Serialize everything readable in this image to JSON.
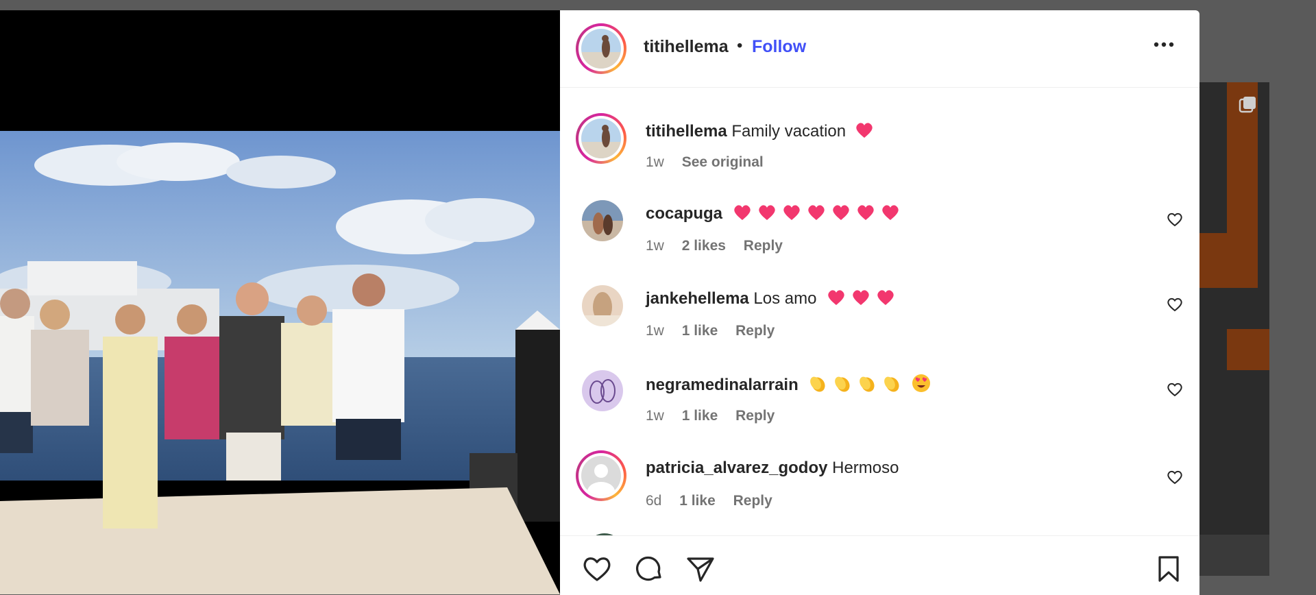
{
  "post": {
    "author": "titihellema",
    "follow_label": "Follow",
    "separator": "•",
    "caption": {
      "username": "titihellema",
      "text": "Family vacation",
      "time": "1w",
      "see_original": "See original"
    }
  },
  "comments": [
    {
      "username": "cocapuga",
      "text": "",
      "emoji_count": 7,
      "emoji": "heart",
      "time": "1w",
      "likes": "2 likes",
      "reply": "Reply"
    },
    {
      "username": "jankehellema",
      "text": "Los amo",
      "emoji_count": 3,
      "emoji": "heart",
      "time": "1w",
      "likes": "1 like",
      "reply": "Reply"
    },
    {
      "username": "negramedinalarrain",
      "text": "",
      "emoji_count": 5,
      "emoji": "clap",
      "time": "1w",
      "likes": "1 like",
      "reply": "Reply"
    },
    {
      "username": "patricia_alvarez_godoy",
      "text": "Hermoso",
      "emoji_count": 0,
      "emoji": "",
      "time": "6d",
      "likes": "1 like",
      "reply": "Reply"
    }
  ],
  "icons": {
    "more": "more-icon",
    "like": "heart-icon",
    "comment": "comment-icon",
    "share": "share-icon",
    "save": "bookmark-icon",
    "carousel": "carousel-icon"
  },
  "colors": {
    "follow": "#4150f7",
    "emoji_heart": "#f2376e",
    "text": "#262626",
    "meta": "#737373"
  }
}
